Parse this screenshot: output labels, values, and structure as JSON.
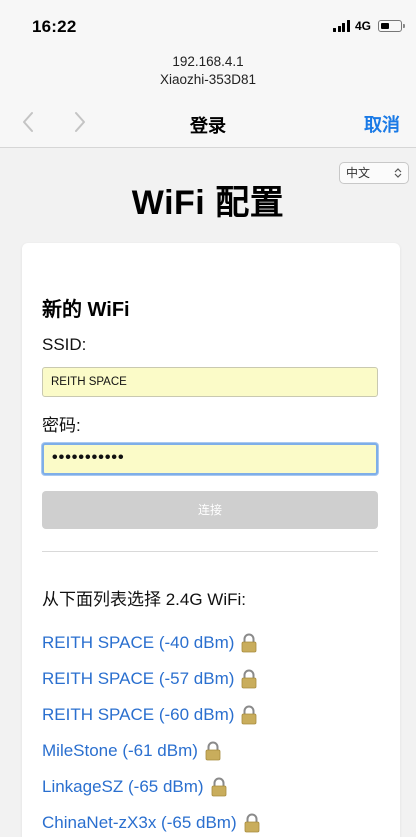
{
  "status_bar": {
    "time": "16:22",
    "network": "4G",
    "signal_bars": 4,
    "battery_level_percent": 35
  },
  "address": {
    "host": "192.168.4.1",
    "name": "Xiaozhi-353D81"
  },
  "navbar": {
    "title": "登录",
    "cancel_label": "取消"
  },
  "language": {
    "selected": "中文"
  },
  "page": {
    "heading": "WiFi 配置"
  },
  "form": {
    "section_title": "新的 WiFi",
    "ssid_label": "SSID:",
    "ssid_value": "REITH SPACE",
    "password_label": "密码:",
    "password_value": "•••••••••••",
    "connect_label": "连接"
  },
  "wifi_list": {
    "heading": "从下面列表选择 2.4G WiFi:",
    "items": [
      "REITH SPACE (-40 dBm)",
      "REITH SPACE (-57 dBm)",
      "REITH SPACE (-60 dBm)",
      "MileStone (-61 dBm)",
      "LinkageSZ (-65 dBm)",
      "ChinaNet-zX3x (-65 dBm)"
    ]
  },
  "colors": {
    "link": "#2a6fcf",
    "accent": "#1a7ae6",
    "input_fill": "#fbfbc8",
    "disabled_button": "#cfcfcf"
  }
}
